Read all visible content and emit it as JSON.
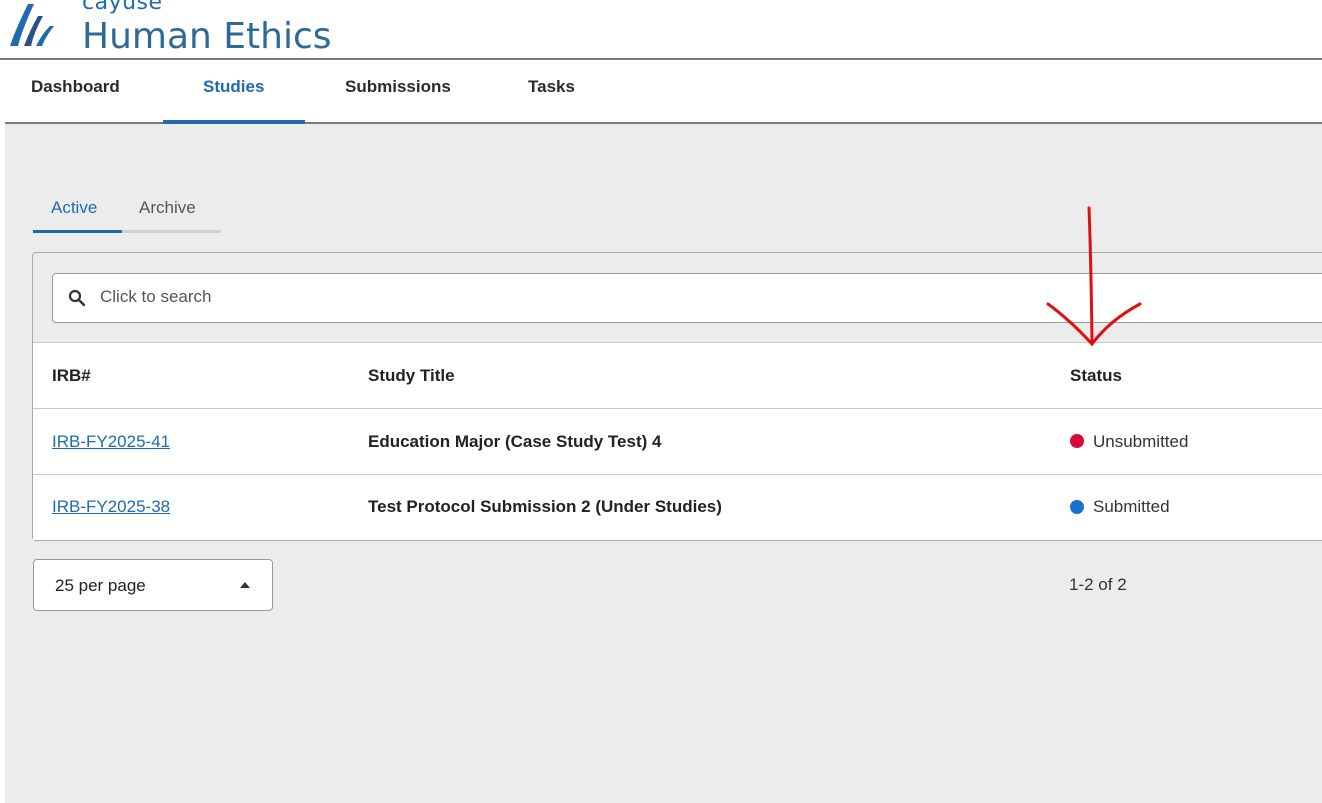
{
  "app": {
    "brand_small": "cayuse",
    "brand_title": "Human Ethics"
  },
  "nav": {
    "items": [
      {
        "label": "Dashboard"
      },
      {
        "label": "Studies"
      },
      {
        "label": "Submissions"
      },
      {
        "label": "Tasks"
      }
    ],
    "active": "Studies"
  },
  "subtabs": {
    "items": [
      {
        "label": "Active"
      },
      {
        "label": "Archive"
      }
    ],
    "active": "Active"
  },
  "search": {
    "placeholder": "Click to search"
  },
  "table": {
    "headers": [
      "IRB#",
      "Study Title",
      "Status"
    ],
    "rows": [
      {
        "irb": "IRB-FY2025-41",
        "title": "Education Major (Case Study Test) 4",
        "status": "Unsubmitted",
        "status_color": "#d6093b"
      },
      {
        "irb": "IRB-FY2025-38",
        "title": "Test Protocol Submission 2 (Under Studies)",
        "status": "Submitted",
        "status_color": "#1a6fd1"
      }
    ]
  },
  "pagination": {
    "per_page": "25 per page",
    "range": "1-2 of 2"
  },
  "colors": {
    "accent": "#1f6bb0",
    "annotation": "#e01010"
  }
}
